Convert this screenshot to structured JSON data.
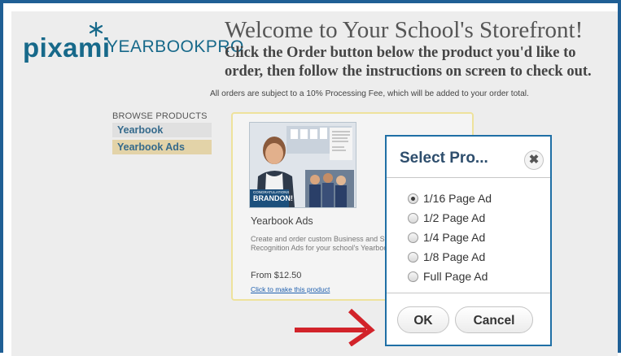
{
  "brand": {
    "logo_word": "pixami",
    "logo_suffix": "YEARBOOKPRO",
    "color": "#17698a"
  },
  "header": {
    "title": "Welcome to Your School's Storefront!",
    "instructions": "Click the Order button below the product you'd like to order, then follow the instructions on screen to check out.",
    "fee_note": "All orders are subject to a 10% Processing Fee, which will be added to your order total."
  },
  "sidebar": {
    "title": "BROWSE PRODUCTS",
    "items": [
      {
        "label": "Yearbook",
        "active": false
      },
      {
        "label": "Yearbook Ads",
        "active": true
      }
    ]
  },
  "product": {
    "title": "Yearbook Ads",
    "description": "Create and order custom Business and Student Recognition Ads for your school's Yearbook!",
    "price": "From $12.50",
    "link": "Click to make this product",
    "image_caption_top": "CONGRATULATIONS",
    "image_caption_name": "BRANDON!"
  },
  "dialog": {
    "title": "Select Pro...",
    "close_icon": "close-icon",
    "options": [
      {
        "label": "1/16 Page Ad",
        "selected": true
      },
      {
        "label": "1/2 Page Ad",
        "selected": false
      },
      {
        "label": "1/4 Page Ad",
        "selected": false
      },
      {
        "label": "1/8 Page Ad",
        "selected": false
      },
      {
        "label": "Full Page Ad",
        "selected": false
      }
    ],
    "ok_label": "OK",
    "cancel_label": "Cancel"
  },
  "colors": {
    "frame": "#1f5f95",
    "arrow": "#d2232a",
    "card_border": "#eee29c"
  }
}
